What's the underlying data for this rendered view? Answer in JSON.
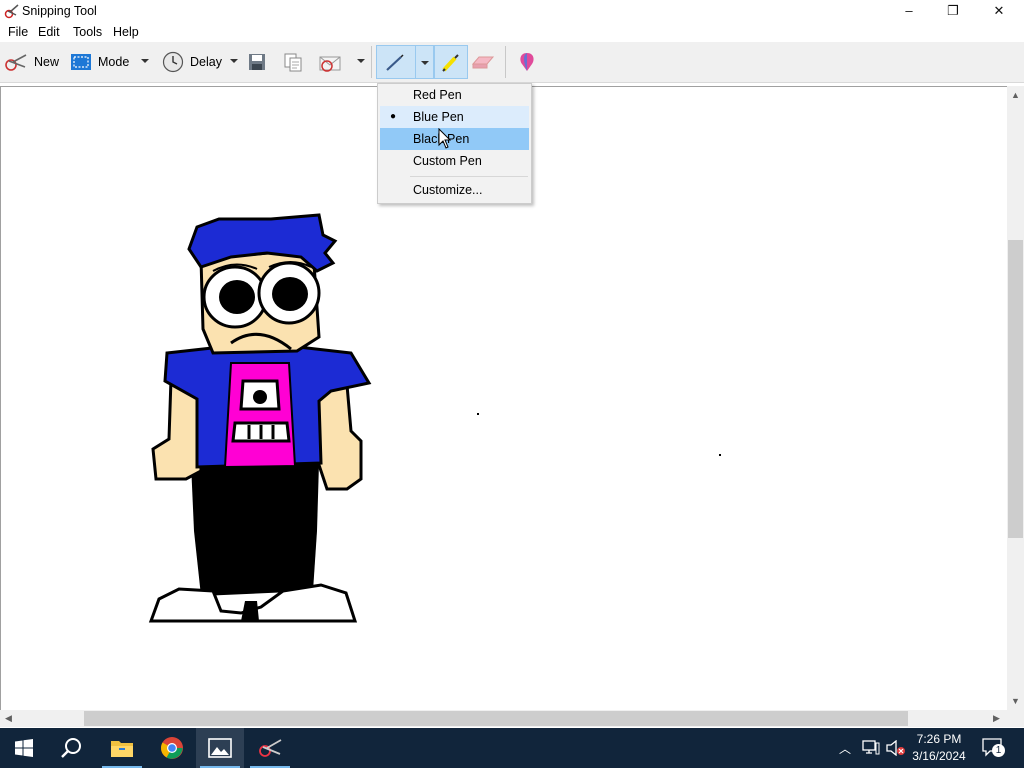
{
  "window": {
    "title": "Snipping Tool",
    "controls": {
      "minimize": "–",
      "maximize": "❐",
      "close": "✕"
    }
  },
  "menu": [
    "File",
    "Edit",
    "Tools",
    "Help"
  ],
  "toolbar": {
    "new_label": "New",
    "mode_label": "Mode",
    "delay_label": "Delay",
    "icons": [
      "new-snip-icon",
      "mode-icon",
      "delay-clock-icon",
      "save-icon",
      "copy-icon",
      "send-icon",
      "pen-icon",
      "highlighter-icon",
      "eraser-icon",
      "paint3d-icon"
    ]
  },
  "pen_menu": {
    "items": [
      {
        "label": "Red Pen",
        "checked": false,
        "hovered": false
      },
      {
        "label": "Blue Pen",
        "checked": true,
        "hovered": false
      },
      {
        "label": "Black Pen",
        "checked": false,
        "hovered": true
      },
      {
        "label": "Custom Pen",
        "checked": false,
        "hovered": false
      }
    ],
    "customize_label": "Customize..."
  },
  "taskbar": {
    "apps": [
      "start-icon",
      "search-icon",
      "file-explorer-icon",
      "chrome-icon",
      "photos-icon",
      "snipping-tool-icon"
    ],
    "time": "7:26 PM",
    "date": "3/16/2024",
    "notification_count": "1"
  },
  "colors": {
    "hair_blue": "#1c2bd4",
    "shirt_magenta": "#ff00d4",
    "skin": "#fbe2b0",
    "accent_blue": "#91c9f7",
    "taskbar": "#11253b"
  }
}
